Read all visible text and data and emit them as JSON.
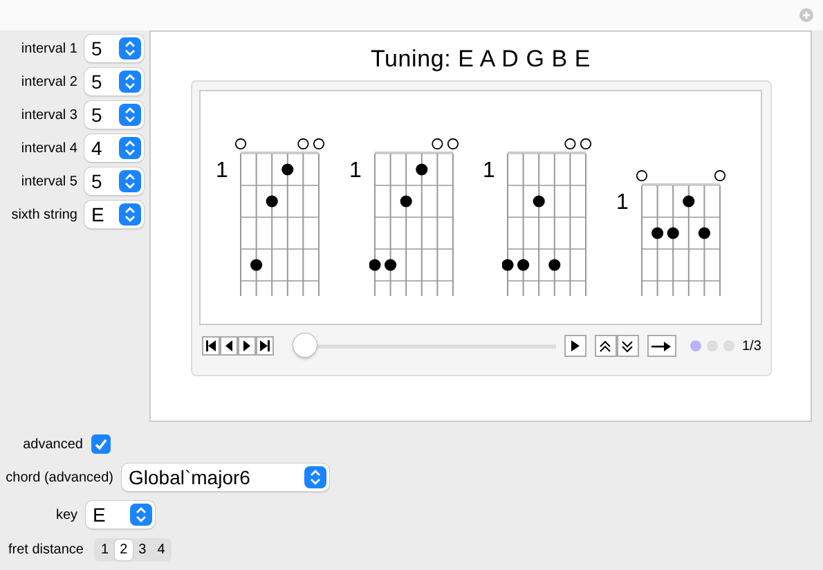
{
  "controls": [
    {
      "label": "interval 1",
      "value": "5"
    },
    {
      "label": "interval 2",
      "value": "5"
    },
    {
      "label": "interval 3",
      "value": "5"
    },
    {
      "label": "interval 4",
      "value": "4"
    },
    {
      "label": "interval 5",
      "value": "5"
    },
    {
      "label": "sixth string",
      "value": "E"
    }
  ],
  "title": "Tuning: E A D G B E",
  "diagrams": [
    {
      "fret_label": "1",
      "open": [
        true,
        false,
        false,
        false,
        true,
        true
      ],
      "rows": [
        [
          false,
          false,
          false,
          true,
          false,
          false
        ],
        [
          false,
          false,
          true,
          false,
          false,
          false
        ],
        [
          false,
          false,
          false,
          false,
          false,
          false
        ],
        [
          false,
          true,
          false,
          false,
          false,
          false
        ]
      ]
    },
    {
      "fret_label": "1",
      "open": [
        false,
        false,
        false,
        false,
        true,
        true
      ],
      "rows": [
        [
          false,
          false,
          false,
          true,
          false,
          false
        ],
        [
          false,
          false,
          true,
          false,
          false,
          false
        ],
        [
          false,
          false,
          false,
          false,
          false,
          false
        ],
        [
          true,
          true,
          false,
          false,
          false,
          false
        ]
      ]
    },
    {
      "fret_label": "1",
      "open": [
        false,
        false,
        false,
        false,
        true,
        true
      ],
      "rows": [
        [
          false,
          false,
          false,
          false,
          false,
          false
        ],
        [
          false,
          false,
          true,
          false,
          false,
          false
        ],
        [
          false,
          false,
          false,
          false,
          false,
          false
        ],
        [
          true,
          true,
          false,
          true,
          false,
          false
        ]
      ]
    },
    {
      "fret_label": "1",
      "open": [
        true,
        false,
        false,
        false,
        false,
        true
      ],
      "rows": [
        [
          false,
          false,
          false,
          true,
          false,
          false
        ],
        [
          false,
          true,
          true,
          false,
          true,
          false
        ],
        [
          false,
          false,
          false,
          false,
          false,
          false
        ]
      ]
    }
  ],
  "player": {
    "level": 0,
    "frame": "1/3",
    "pages": [
      {
        "selected": true
      },
      {
        "selected": false
      },
      {
        "selected": false
      }
    ]
  },
  "advanced": {
    "label": "advanced",
    "checked": true
  },
  "chord": {
    "label": "chord (advanced)",
    "value": "Global`major6"
  },
  "key": {
    "label": "key",
    "value": "E"
  },
  "fret_distance": {
    "label": "fret distance",
    "options": [
      {
        "label": "1",
        "selected": false
      },
      {
        "label": "2",
        "selected": true
      },
      {
        "label": "3",
        "selected": false
      },
      {
        "label": "4",
        "selected": false
      }
    ]
  }
}
